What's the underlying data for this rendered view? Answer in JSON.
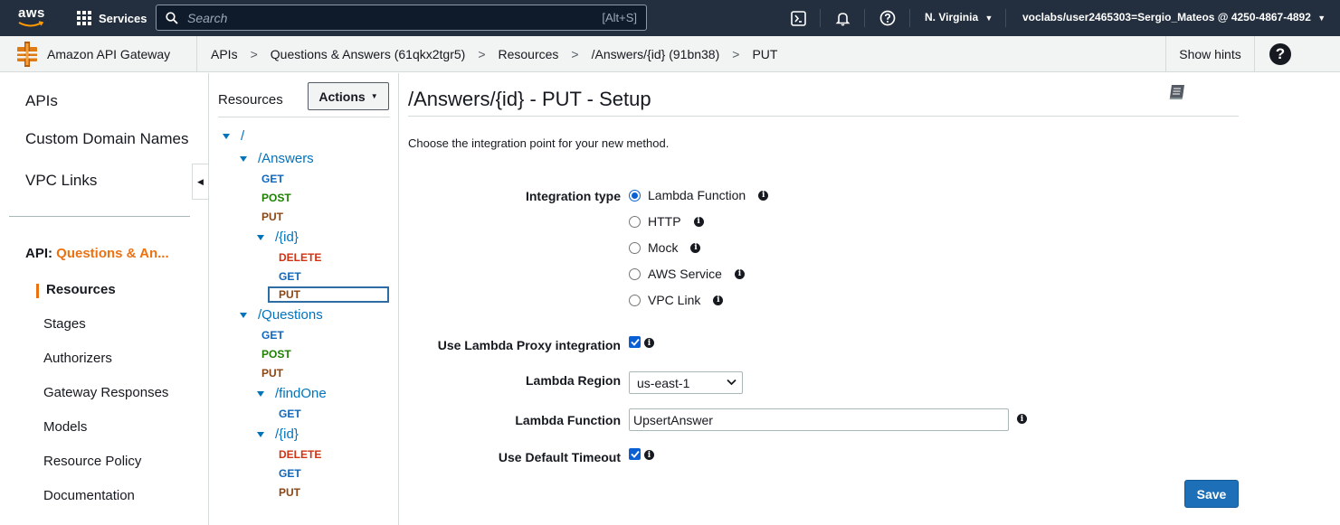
{
  "topbar": {
    "logo_text": "aws",
    "services_label": "Services",
    "search_placeholder": "Search",
    "search_shortcut": "[Alt+S]",
    "region": "N. Virginia",
    "account": "voclabs/user2465303=Sergio_Mateos @ 4250-4867-4892"
  },
  "breadcrumb": {
    "service_name": "Amazon API Gateway",
    "items": [
      "APIs",
      "Questions & Answers (61qkx2tgr5)",
      "Resources",
      "/Answers/{id} (91bn38)",
      "PUT"
    ],
    "separator": ">",
    "show_hints_label": "Show hints",
    "help_label": "?"
  },
  "sidebar": {
    "top_items": [
      "APIs",
      "Custom Domain Names",
      "VPC Links"
    ],
    "api_prefix": "API:",
    "api_name": "Questions & An...",
    "sub_items": [
      "Resources",
      "Stages",
      "Authorizers",
      "Gateway Responses",
      "Models",
      "Resource Policy",
      "Documentation"
    ]
  },
  "resources": {
    "title": "Resources",
    "actions_label": "Actions",
    "tree": {
      "root": "/",
      "answers": "/Answers",
      "answers_methods": [
        "GET",
        "POST",
        "PUT"
      ],
      "answers_id": "/{id}",
      "answers_id_methods": [
        "DELETE",
        "GET",
        "PUT"
      ],
      "questions": "/Questions",
      "questions_methods": [
        "GET",
        "POST",
        "PUT"
      ],
      "find_one": "/findOne",
      "find_one_methods": [
        "GET"
      ],
      "questions_id": "/{id}",
      "questions_id_methods": [
        "DELETE",
        "GET",
        "PUT"
      ]
    }
  },
  "main": {
    "title": "/Answers/{id} - PUT - Setup",
    "intro": "Choose the integration point for your new method.",
    "integration_type_label": "Integration type",
    "integration_options": [
      "Lambda Function",
      "HTTP",
      "Mock",
      "AWS Service",
      "VPC Link"
    ],
    "selected_integration": "Lambda Function",
    "proxy_label": "Use Lambda Proxy integration",
    "proxy_checked": true,
    "region_label": "Lambda Region",
    "region_value": "us-east-1",
    "function_label": "Lambda Function",
    "function_value": "UpsertAnswer",
    "timeout_label": "Use Default Timeout",
    "timeout_checked": true,
    "save_label": "Save"
  },
  "colors": {
    "topbar_bg": "#232f3e",
    "accent_orange": "#ec7211",
    "link_blue": "#0073bb",
    "primary_button": "#1d70b8",
    "method_get": "#1166bb",
    "method_post": "#1d8102",
    "method_put": "#8b4513",
    "method_delete": "#d13212"
  }
}
